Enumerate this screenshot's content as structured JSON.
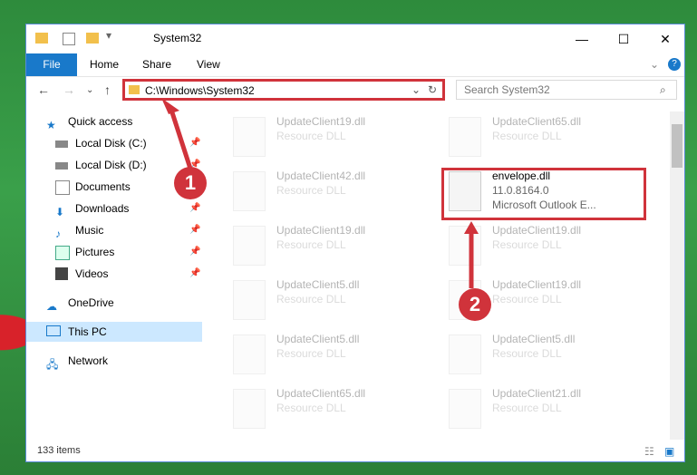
{
  "window": {
    "title": "System32",
    "min_icon": "minimize-icon",
    "max_icon": "maximize-icon",
    "close_icon": "close-icon"
  },
  "ribbon": {
    "file": "File",
    "home": "Home",
    "share": "Share",
    "view": "View"
  },
  "address": {
    "path": "C:\\Windows\\System32",
    "search_placeholder": "Search System32"
  },
  "sidebar": {
    "items": [
      {
        "label": "Quick access",
        "icon": "star-icon"
      },
      {
        "label": "Local Disk (C:)",
        "icon": "drive-icon"
      },
      {
        "label": "Local Disk (D:)",
        "icon": "drive-icon"
      },
      {
        "label": "Documents",
        "icon": "documents-icon"
      },
      {
        "label": "Downloads",
        "icon": "downloads-icon"
      },
      {
        "label": "Music",
        "icon": "music-icon"
      },
      {
        "label": "Pictures",
        "icon": "pictures-icon"
      },
      {
        "label": "Videos",
        "icon": "videos-icon"
      },
      {
        "label": "OneDrive",
        "icon": "cloud-icon"
      },
      {
        "label": "This PC",
        "icon": "computer-icon"
      },
      {
        "label": "Network",
        "icon": "network-icon"
      }
    ]
  },
  "files": [
    {
      "name": "UpdateClient19.dll",
      "sub": "Resource DLL"
    },
    {
      "name": "UpdateClient65.dll",
      "sub": "Resource DLL"
    },
    {
      "name": "UpdateClient42.dll",
      "sub": "Resource DLL"
    },
    {
      "name": "envelope.dll",
      "sub": "11.0.8164.0",
      "sub2": "Microsoft Outlook E..."
    },
    {
      "name": "UpdateClient19.dll",
      "sub": "Resource DLL"
    },
    {
      "name": "UpdateClient19.dll",
      "sub": "Resource DLL"
    },
    {
      "name": "UpdateClient5.dll",
      "sub": "Resource DLL"
    },
    {
      "name": "UpdateClient19.dll",
      "sub": "Resource DLL"
    },
    {
      "name": "UpdateClient5.dll",
      "sub": "Resource DLL"
    },
    {
      "name": "UpdateClient5.dll",
      "sub": "Resource DLL"
    },
    {
      "name": "UpdateClient65.dll",
      "sub": "Resource DLL"
    },
    {
      "name": "UpdateClient21.dll",
      "sub": "Resource DLL"
    }
  ],
  "status": {
    "count": "133 items"
  },
  "annotations": {
    "one": "1",
    "two": "2"
  },
  "colors": {
    "accent": "#1979ca",
    "highlight": "#d0333b"
  }
}
